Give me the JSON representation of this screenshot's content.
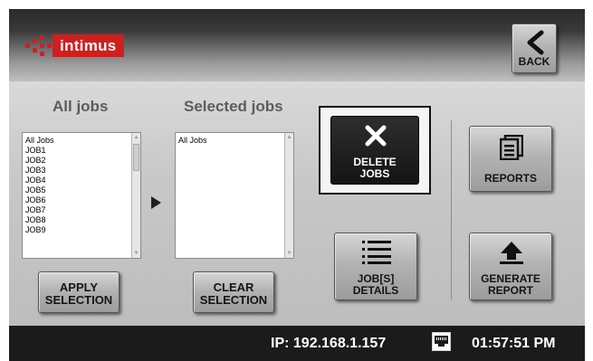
{
  "header": {
    "logo_text": "intimus",
    "back_label": "BACK"
  },
  "all_jobs": {
    "title": "All jobs",
    "items": [
      "All Jobs",
      "JOB1",
      "JOB2",
      "JOB3",
      "JOB4",
      "JOB5",
      "JOB6",
      "JOB7",
      "JOB8",
      "JOB9"
    ]
  },
  "selected_jobs": {
    "title": "Selected jobs",
    "items": [
      "All Jobs"
    ]
  },
  "buttons": {
    "apply_line1": "APPLY",
    "apply_line2": "SELECTION",
    "clear_line1": "CLEAR",
    "clear_line2": "SELECTION",
    "delete_line1": "DELETE",
    "delete_line2": "JOBS",
    "details_line1": "JOB[S]",
    "details_line2": "DETAILS",
    "reports": "REPORTS",
    "generate_line1": "GENERATE",
    "generate_line2": "REPORT"
  },
  "status": {
    "ip": "IP: 192.168.1.157",
    "time": "01:57:51 PM"
  },
  "icons": {
    "back": "chevron-left-icon",
    "delete": "x-icon",
    "details": "list-icon",
    "reports": "document-stack-icon",
    "generate": "upload-arrow-icon",
    "network": "ethernet-port-icon"
  },
  "colors": {
    "brand": "#cf1f1f",
    "status_bar": "#1b1b1b",
    "active_button": "#1c1c1c"
  }
}
